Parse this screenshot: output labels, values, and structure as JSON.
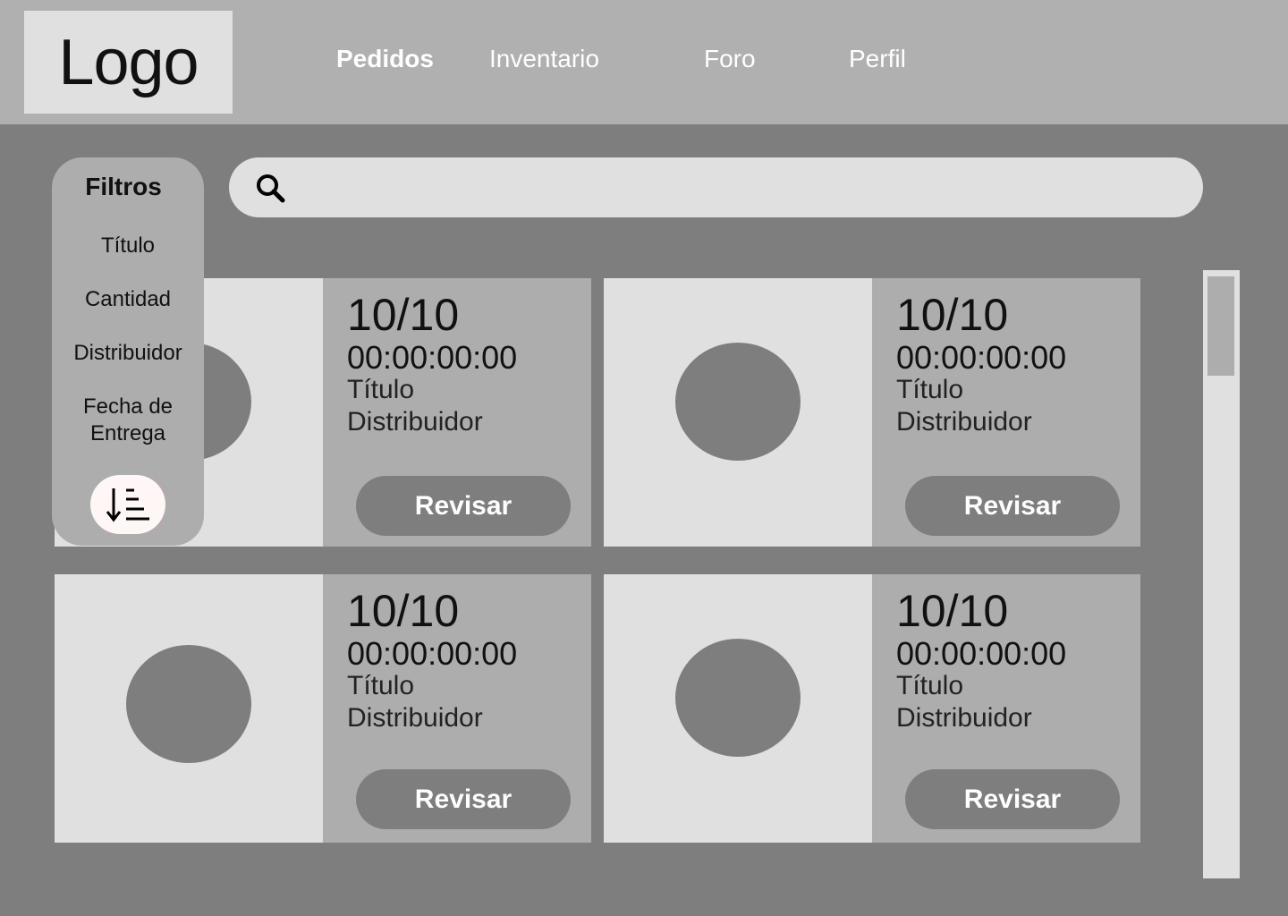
{
  "header": {
    "logo": "Logo",
    "nav": [
      {
        "label": "Pedidos",
        "active": true
      },
      {
        "label": "Inventario"
      },
      {
        "label": "Foro"
      },
      {
        "label": "Perfil"
      }
    ]
  },
  "search": {
    "placeholder": "",
    "value": ""
  },
  "filters": {
    "title": "Filtros",
    "options": [
      "Título",
      "Cantidad",
      "Distribuidor",
      "Fecha de Entrega"
    ],
    "sort_icon": "sort-descending-icon"
  },
  "cards": [
    {
      "score": "10/10",
      "time": "00:00:00:00",
      "title": "Título",
      "distributor": "Distribuidor",
      "button": "Revisar"
    },
    {
      "score": "10/10",
      "time": "00:00:00:00",
      "title": "Título",
      "distributor": "Distribuidor",
      "button": "Revisar"
    },
    {
      "score": "10/10",
      "time": "00:00:00:00",
      "title": "Título",
      "distributor": "Distribuidor",
      "button": "Revisar"
    },
    {
      "score": "10/10",
      "time": "00:00:00:00",
      "title": "Título",
      "distributor": "Distribuidor",
      "button": "Revisar"
    }
  ],
  "colors": {
    "background": "#7e7e7e",
    "header": "#b0b0b0",
    "panel_light": "#e0e0e0",
    "panel_mid": "#adadad",
    "sort_button": "#fff6f6"
  }
}
